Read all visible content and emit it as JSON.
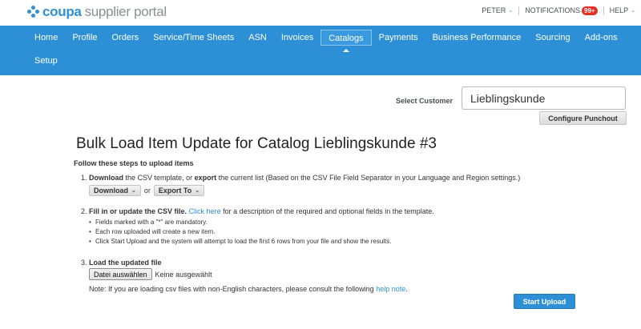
{
  "header": {
    "logo_brand": "coupa",
    "logo_product": "supplier portal",
    "user_label": "PETER",
    "notifications_label": "NOTIFICATIONS",
    "notifications_badge": "99+",
    "help_label": "HELP"
  },
  "nav": {
    "row1": [
      "Home",
      "Profile",
      "Orders",
      "Service/Time Sheets",
      "ASN",
      "Invoices",
      "Catalogs",
      "Payments",
      "Business Performance",
      "Sourcing",
      "Add-ons"
    ],
    "row2": [
      "Setup"
    ],
    "active": "Catalogs"
  },
  "customer": {
    "label": "Select Customer",
    "value": "Lieblingskunde",
    "configure_button": "Configure Punchout"
  },
  "page": {
    "title": "Bulk Load Item Update for Catalog Lieblingskunde #3",
    "steps_heading": "Follow these steps to upload items"
  },
  "step1": {
    "number": "1.",
    "bold1": "Download",
    "text1": " the CSV template, or ",
    "bold2": "export",
    "text2": " the current list (Based on the CSV File Field Separator in your Language and Region settings.)",
    "download_label": "Download",
    "or_label": "or",
    "export_label": "Export To"
  },
  "step2": {
    "number": "2.",
    "bold": "Fill in or update the CSV file.",
    "link": "Click here",
    "text": " for a description of the required and optional fields in the template.",
    "bullets": [
      "Fields marked with a \"*\" are mandatory.",
      "Each row uploaded will create a new item.",
      "Click Start Upload and the system will attempt to load the first 6 rows from your file and show the results."
    ]
  },
  "step3": {
    "number": "3.",
    "bold": "Load the updated file",
    "file_button": "Datei auswählen",
    "file_none": "Keine ausgewählt",
    "note_text": "Note: If you are loading csv files with non-English characters, please consult the following ",
    "note_link": "help note",
    "note_end": "."
  },
  "actions": {
    "start_upload": "Start Upload"
  },
  "colors": {
    "brand_blue": "#2d8fd5",
    "badge_red": "#e32f25"
  }
}
